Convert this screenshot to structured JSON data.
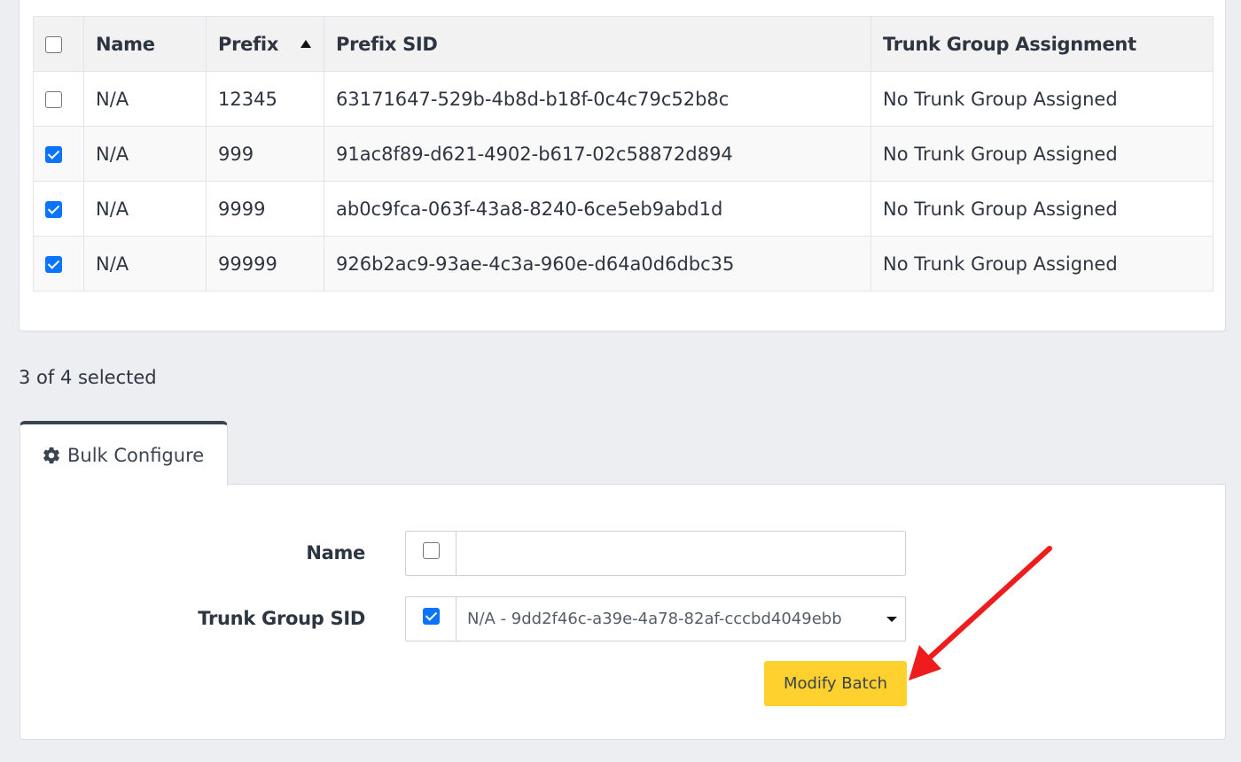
{
  "table": {
    "columns": [
      {
        "key": "select",
        "label": ""
      },
      {
        "key": "name",
        "label": "Name"
      },
      {
        "key": "prefix",
        "label": "Prefix",
        "sorted": "ascending"
      },
      {
        "key": "prefix_sid",
        "label": "Prefix SID"
      },
      {
        "key": "trunk_group",
        "label": "Trunk Group Assignment"
      }
    ],
    "select_all_checked": false,
    "rows": [
      {
        "checked": false,
        "name": "N/A",
        "prefix": "12345",
        "prefix_sid": "63171647-529b-4b8d-b18f-0c4c79c52b8c",
        "trunk_group": "No Trunk Group Assigned"
      },
      {
        "checked": true,
        "name": "N/A",
        "prefix": "999",
        "prefix_sid": "91ac8f89-d621-4902-b617-02c58872d894",
        "trunk_group": "No Trunk Group Assigned"
      },
      {
        "checked": true,
        "name": "N/A",
        "prefix": "9999",
        "prefix_sid": "ab0c9fca-063f-43a8-8240-6ce5eb9abd1d",
        "trunk_group": "No Trunk Group Assigned"
      },
      {
        "checked": true,
        "name": "N/A",
        "prefix": "99999",
        "prefix_sid": "926b2ac9-93ae-4c3a-960e-d64a0d6dbc35",
        "trunk_group": "No Trunk Group Assigned"
      }
    ]
  },
  "selection": {
    "text": "3 of 4 selected"
  },
  "bulk": {
    "tab_label": "Bulk Configure",
    "tab_icon": "gear-icon",
    "name_field": {
      "label": "Name",
      "enabled": false,
      "value": ""
    },
    "trunk_field": {
      "label": "Trunk Group SID",
      "enabled": true,
      "value": "N/A - 9dd2f46c-a39e-4a78-82af-cccbd4049ebb"
    },
    "submit_label": "Modify Batch"
  },
  "colors": {
    "accent_button": "#ffd12e",
    "checkbox_checked": "#0b74ff",
    "annotation_arrow": "#ee1c1c"
  }
}
